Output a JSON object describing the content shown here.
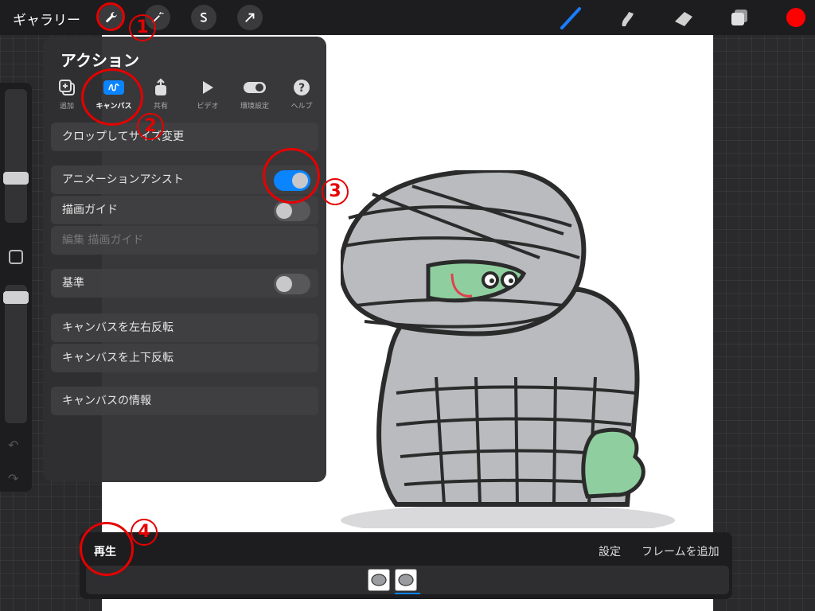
{
  "topbar": {
    "gallery_label": "ギャラリー",
    "tools_left": [
      "wrench-icon",
      "magic-wand-icon",
      "selection-s-icon",
      "arrow-cursor-icon"
    ],
    "tools_right": [
      "brush-icon",
      "smudge-icon",
      "eraser-icon",
      "layers-icon"
    ],
    "current_color": "#ff0000"
  },
  "action_panel": {
    "title": "アクション",
    "tabs": [
      {
        "label": "追加",
        "icon": "add-icon"
      },
      {
        "label": "キャンバス",
        "icon": "canvas-icon",
        "active": true
      },
      {
        "label": "共有",
        "icon": "share-icon"
      },
      {
        "label": "ビデオ",
        "icon": "video-icon"
      },
      {
        "label": "環境設定",
        "icon": "toggle-icon"
      },
      {
        "label": "ヘルプ",
        "icon": "help-icon"
      }
    ],
    "rows": {
      "crop": "クロップしてサイズ変更",
      "animation_assist": "アニメーションアシスト",
      "drawing_guide": "描画ガイド",
      "edit_drawing_guide": "編集 描画ガイド",
      "reference": "基準",
      "flip_horizontal": "キャンバスを左右反転",
      "flip_vertical": "キャンバスを上下反転",
      "canvas_info": "キャンバスの情報"
    },
    "toggles": {
      "animation_assist": true,
      "drawing_guide": false,
      "reference": false
    }
  },
  "timeline": {
    "play_label": "再生",
    "settings_label": "設定",
    "add_frame_label": "フレームを追加",
    "frame_count": 2
  },
  "annotations": {
    "n1": "1",
    "n2": "2",
    "n3": "3",
    "n4": "4",
    "color": "#e60000"
  }
}
